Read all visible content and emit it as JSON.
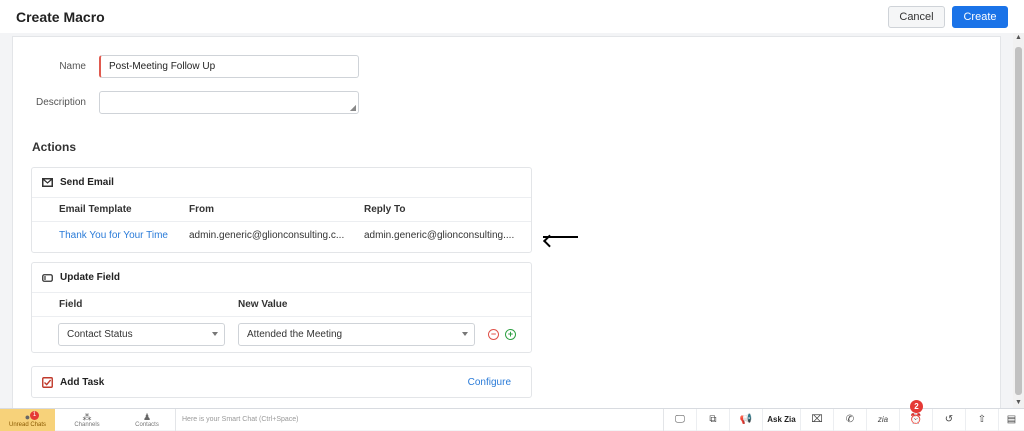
{
  "header": {
    "title": "Create Macro",
    "cancel_label": "Cancel",
    "create_label": "Create"
  },
  "form": {
    "name_label": "Name",
    "name_value": "Post-Meeting Follow Up",
    "description_label": "Description",
    "description_value": ""
  },
  "actions": {
    "title": "Actions",
    "send_email": {
      "title": "Send Email",
      "columns": [
        "Email Template",
        "From",
        "Reply To"
      ],
      "row": {
        "template": "Thank You for Your Time",
        "from": "admin.generic@glionconsulting.c...",
        "reply_to": "admin.generic@glionconsulting...."
      }
    },
    "update_field": {
      "title": "Update Field",
      "columns": [
        "Field",
        "New Value"
      ],
      "field_value": "Contact Status",
      "new_value": "Attended the Meeting"
    },
    "add_task": {
      "title": "Add Task",
      "configure_label": "Configure"
    }
  },
  "bottom_bar": {
    "unread_label": "Unread Chats",
    "unread_count": "1",
    "channels_label": "Channels",
    "contacts_label": "Contacts",
    "smart_chat_placeholder": "Here is your Smart Chat (Ctrl+Space)",
    "ask_zia_label": "Ask Zia",
    "alarm_badge": "2"
  },
  "colors": {
    "primary": "#1a73e8",
    "link": "#2a7bd8",
    "required": "#e05a4f",
    "remove": "#e0524a",
    "add": "#2ea043",
    "unread_bg": "#f7d27a"
  }
}
